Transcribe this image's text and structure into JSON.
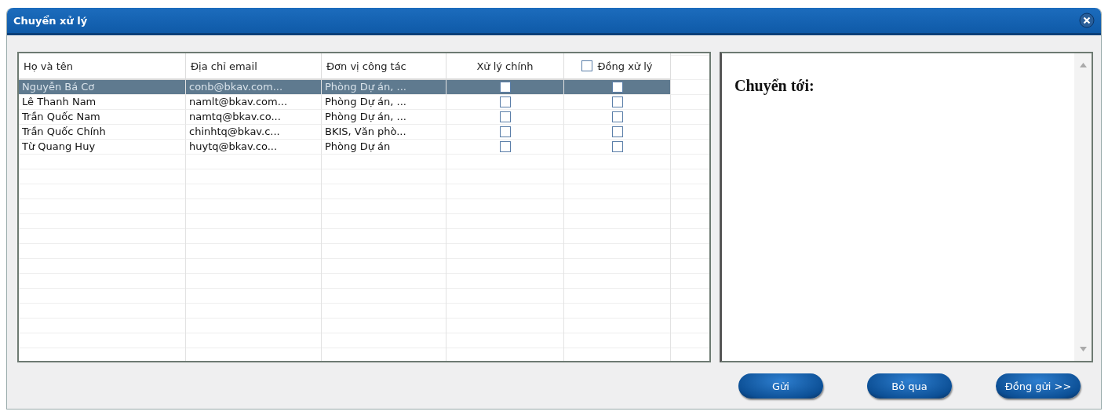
{
  "window": {
    "title": "Chuyển xử lý"
  },
  "table": {
    "columns": [
      {
        "label": "Họ và tên"
      },
      {
        "label": "Địa chỉ email"
      },
      {
        "label": "Đơn vị công tác"
      },
      {
        "label": "Xử lý chính"
      },
      {
        "label": "Đồng xử lý",
        "checked": false
      }
    ],
    "rows": [
      {
        "name": "Nguyễn Bá Cơ",
        "email": "conb@bkav.com...",
        "unit": "Phòng Dự án, ...",
        "main": false,
        "co": false,
        "selected": true
      },
      {
        "name": "Lê Thanh Nam",
        "email": "namlt@bkav.com...",
        "unit": "Phòng Dự án, ...",
        "main": false,
        "co": false,
        "selected": false
      },
      {
        "name": "Trần Quốc Nam",
        "email": "namtq@bkav.co...",
        "unit": "Phòng Dự án, ...",
        "main": false,
        "co": false,
        "selected": false
      },
      {
        "name": "Trần Quốc Chính",
        "email": "chinhtq@bkav.c...",
        "unit": "BKIS, Văn phò...",
        "main": false,
        "co": false,
        "selected": false
      },
      {
        "name": "Từ Quang Huy",
        "email": "huytq@bkav.co...",
        "unit": "Phòng Dự án",
        "main": false,
        "co": false,
        "selected": false
      }
    ]
  },
  "recipients": {
    "heading": "Chuyển tới:"
  },
  "buttons": [
    "Gửi",
    "Bỏ qua",
    "Đồng gửi >>"
  ]
}
